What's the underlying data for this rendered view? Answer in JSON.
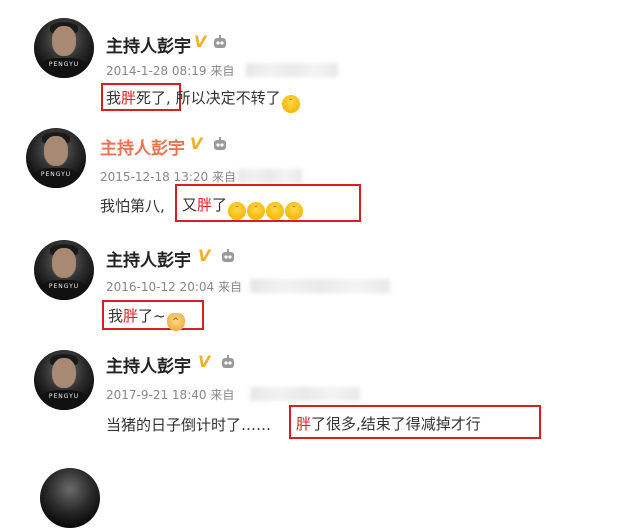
{
  "posts": [
    {
      "name": "主持人彭宇",
      "v_badge": "V",
      "avatar_tag": "PENGYU",
      "meta": "2014-1-28 08:19 来自",
      "text_before": "",
      "text_highlight_pre": "我",
      "text_highlight": "胖",
      "text_highlight_post": "死了,",
      "text_after": " 所以决定不转了",
      "emoji_count": 1,
      "emoji_name": "cry-emoji"
    },
    {
      "name": "主持人彭宇",
      "v_badge": "V",
      "avatar_tag": "PENGYU",
      "meta": "2015-12-18 13:20 来自",
      "text_before": "我怕第八,",
      "text_highlight_pre": "又",
      "text_highlight": "胖",
      "text_highlight_post": "了",
      "text_after": "",
      "emoji_count": 4,
      "emoji_name": "cry-emoji"
    },
    {
      "name": "主持人彭宇",
      "v_badge": "V",
      "avatar_tag": "PENGYU",
      "meta": "2016-10-12 20:04 来自",
      "text_before": "",
      "text_highlight_pre": "我",
      "text_highlight": "胖",
      "text_highlight_post": "了~",
      "text_after": "",
      "emoji_count": 1,
      "emoji_name": "pray-emoji"
    },
    {
      "name": "主持人彭宇",
      "v_badge": "V",
      "avatar_tag": "PENGYU",
      "meta": "2017-9-21 18:40 来自",
      "text_before": "当猪的日子倒计时了……",
      "text_highlight_pre": "",
      "text_highlight": "胖",
      "text_highlight_post": "了很多,结束了得减掉才行",
      "text_after": "",
      "emoji_count": 0,
      "emoji_name": ""
    }
  ],
  "colors": {
    "highlight_red": "#e02020",
    "box_red": "#d42020",
    "vip_gold": "#f3b02e",
    "name_orange": "#eb7350"
  }
}
